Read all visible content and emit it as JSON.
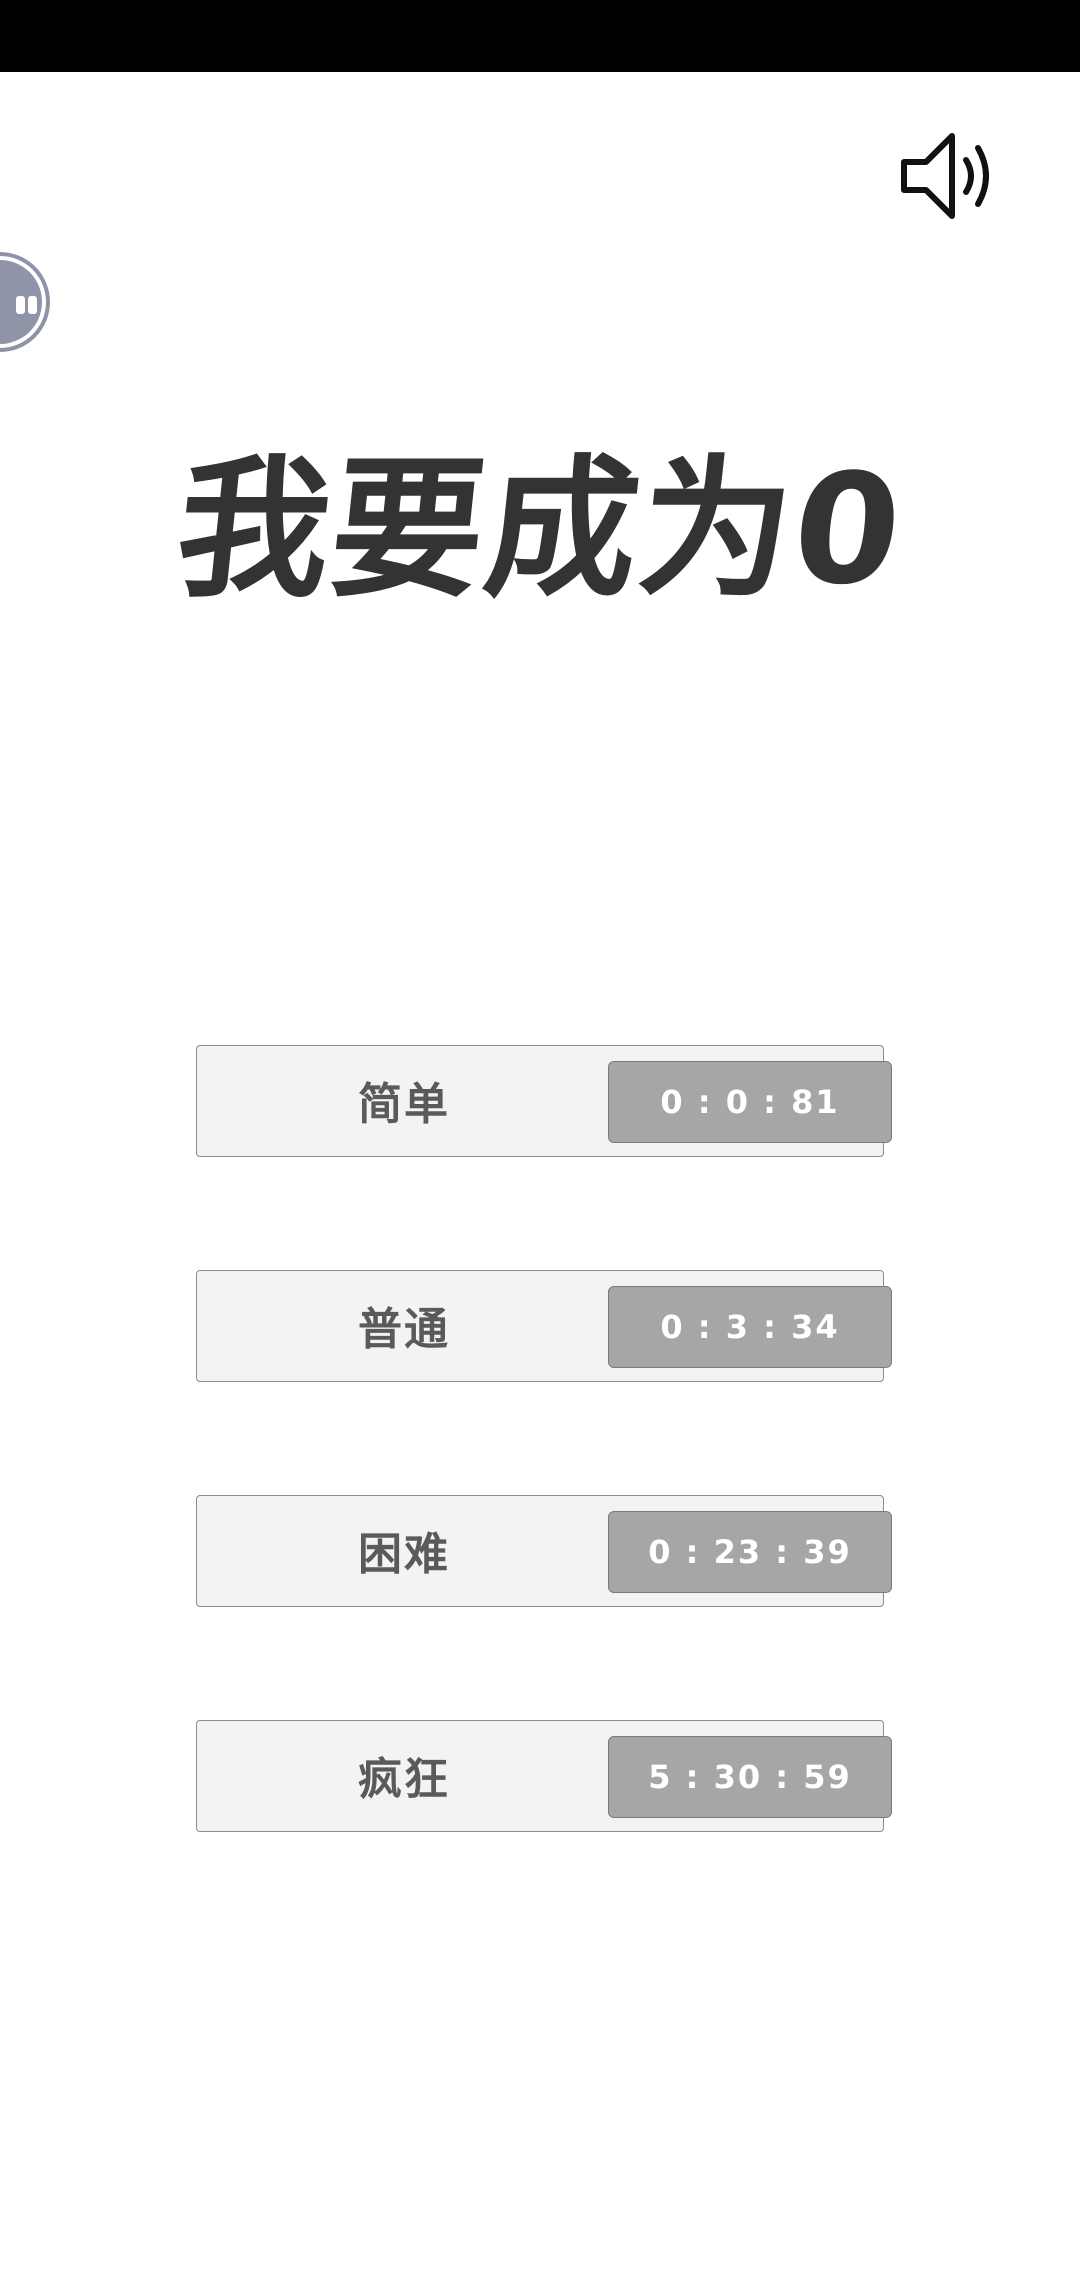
{
  "header": {
    "sound_icon": "speaker-volume-icon"
  },
  "title": "我要成为0",
  "levels": [
    {
      "label": "简单",
      "best_time": "0 : 0 : 81"
    },
    {
      "label": "普通",
      "best_time": "0 : 3 : 34"
    },
    {
      "label": "困难",
      "best_time": "0 : 23 : 39"
    },
    {
      "label": "疯狂",
      "best_time": "5 : 30 : 59"
    }
  ],
  "colors": {
    "title": "#333333",
    "card_bg": "#f3f3f3",
    "badge_bg": "#a6a6a6",
    "status_bar": "#000000"
  }
}
